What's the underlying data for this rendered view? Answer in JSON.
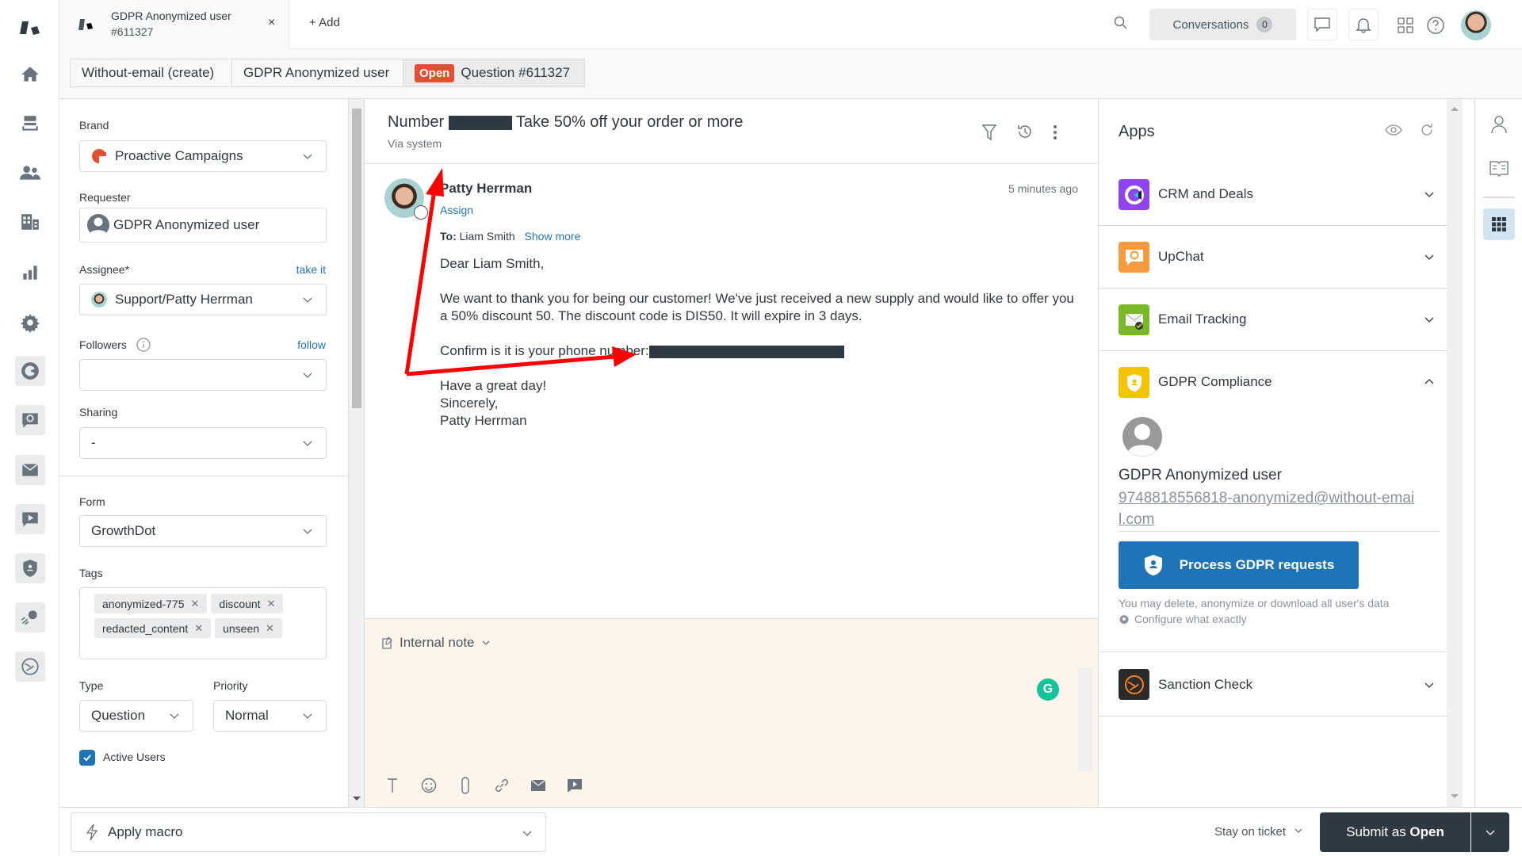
{
  "header": {
    "ticket_tab": {
      "title": "GDPR Anonymized user",
      "subtitle": "#611327",
      "close": "×"
    },
    "add_tab": "+ Add",
    "conversations": {
      "label": "Conversations",
      "count": "0"
    }
  },
  "breadcrumbs": [
    {
      "label": "Without-email (create)"
    },
    {
      "label": "GDPR Anonymized user"
    },
    {
      "status": "Open",
      "label": "Question #611327"
    }
  ],
  "properties": {
    "brand": {
      "label": "Brand",
      "value": "Proactive Campaigns"
    },
    "requester": {
      "label": "Requester",
      "value": "GDPR Anonymized user"
    },
    "assignee": {
      "label": "Assignee*",
      "link": "take it",
      "value": "Support/Patty Herrman"
    },
    "followers": {
      "label": "Followers",
      "link": "follow",
      "value": ""
    },
    "sharing": {
      "label": "Sharing",
      "value": "-"
    },
    "form": {
      "label": "Form",
      "value": "GrowthDot"
    },
    "tags": {
      "label": "Tags",
      "items": [
        "anonymized-775",
        "discount",
        "redacted_content",
        "unseen"
      ]
    },
    "type": {
      "label": "Type",
      "value": "Question"
    },
    "priority": {
      "label": "Priority",
      "value": "Normal"
    },
    "active_users": {
      "label": "Active Users",
      "checked": true
    }
  },
  "conversation": {
    "subject_prefix": "Number",
    "subject_suffix": "Take 50% off your order or more",
    "via": "Via system",
    "message": {
      "sender": "Patty Herrman",
      "assign": "Assign",
      "time": "5 minutes ago",
      "to_label": "To:",
      "to": "Liam Smith",
      "show_more": "Show more",
      "greeting": "Dear Liam Smith,",
      "para1": "We want to thank you for being our customer! We've just received a new supply and would like to offer you a 50% discount 50. The discount code is DIS50. It will expire in 3 days.",
      "phone_prompt": "Confirm is it is your phone number:",
      "closing1": "Have a great day!",
      "closing2": "Sincerely,",
      "closing3": "Patty Herrman"
    }
  },
  "composer": {
    "mode": "Internal note",
    "grammarly": "G"
  },
  "apps": {
    "title": "Apps",
    "items": [
      {
        "name": "CRM and Deals",
        "color": "#8e44ef",
        "expanded": false
      },
      {
        "name": "UpChat",
        "color": "#f79a3e",
        "expanded": false
      },
      {
        "name": "Email Tracking",
        "color": "#78b829",
        "expanded": false
      },
      {
        "name": "GDPR Compliance",
        "color": "#f5c400",
        "expanded": true
      },
      {
        "name": "Sanction Check",
        "color": "#2b2b2b",
        "expanded": false
      }
    ],
    "gdpr": {
      "user_name": "GDPR Anonymized user",
      "email": "9748818556818-anonymized@without-email.com",
      "button": "Process GDPR requests",
      "note": "You may delete, anonymize or download all user's data",
      "configure": "Configure what exactly"
    }
  },
  "footer": {
    "macro": "Apply macro",
    "stay": "Stay on ticket",
    "submit_prefix": "Submit as ",
    "submit_status": "Open"
  },
  "colors": {
    "open_status": "#e34f32",
    "primary_blue": "#1f73b7",
    "dark": "#2f3941",
    "composer_bg": "#fdf5ec"
  }
}
